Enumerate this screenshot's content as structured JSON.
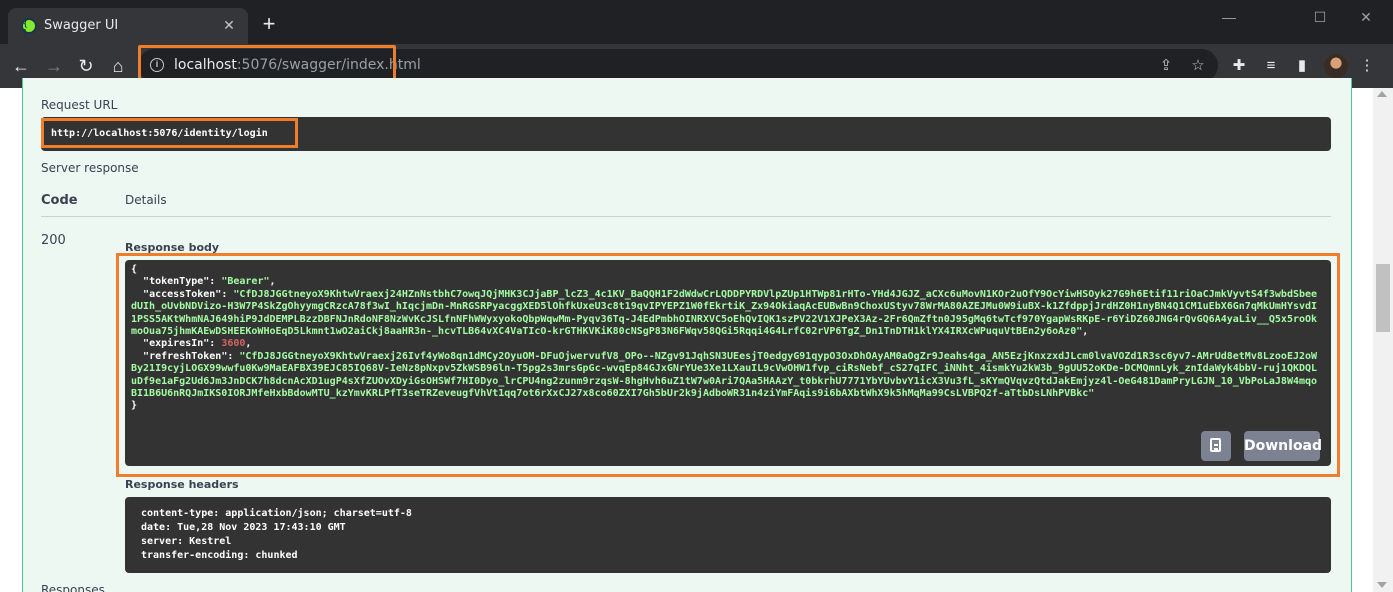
{
  "browser": {
    "tab_title": "Swagger UI",
    "url_host": "localhost",
    "url_rest": ":5076/swagger/index.html"
  },
  "request_url": {
    "label": "Request URL",
    "value": "http://localhost:5076/identity/login"
  },
  "server_response": {
    "label": "Server response",
    "code_header": "Code",
    "details_header": "Details",
    "code": "200",
    "body_label": "Response body",
    "body": {
      "open": "{",
      "token_type_key": "  \"tokenType\": ",
      "token_type_value": "\"Bearer\"",
      "access_token_key": "  \"accessToken\": ",
      "access_token_value": "\"CfDJ8JGGtneyoX9KhtwVraexj24HZnNstbhC7owqJQjMHK3CJjaBP_lcZ3_4c1KV_BaQQH1F2dWdwCrLQDDPYRDVlpZUp1HTWp81rHTo-YHd4JGJZ_aCXc6uMovN1KOr2uOfY9OcYiwHSOyk27G9h6Etif11riOaCJmkVyvtS4f3wbdSbeedUIh_oUvbNDVizo-H3W7P4SkZgOhyymgCRzcA78f3wI_hIqcjmDn-MnRGSRPyacggXED5lOhfkUxeU3c8t19qvIPYEPZ1W0fEkrtiK_Zx94OkiaqAcEUBwBn9ChoxUStyv78WrMA80AZEJMu0W9iuBX-k1ZfdppjJrdHZ0H1nyBN4Q1CM1uEbX6Gn7qMkUmHYsvdI1PSS5AKtWhmNAJ649hiP9JdDEMPLBzzDBFNJnRdoNF8NzWvKcJSLfnNFhWWyxyokoQbpWqwMm-Pyqv36Tq-J4EdPmbhOINRXVC5oEhQvIQK1szPV22V1XJPeX3Az-2Fr6QmZftn0J95gMq6twTcf970YgapWsRKpE-r6YiDZ60JNG4rQvGQ6A4yaLiv__Q5x5roOkmoOua75jhmKAEwDSHEEKoWHoEqD5Lkmnt1wO2aiCkj8aaHR3n-_hcvTLB64vXC4VaTIcO-krGTHKVKiK80cNSgP83N6FWqv58QGi5Rqqi4G4LrfC02rVP6TgZ_Dn1TnDTH1klYX4IRXcWPuquVtBEn2y6oAz0\"",
      "expires_in_key": "  \"expiresIn\": ",
      "expires_in_value": "3600",
      "refresh_token_key": "  \"refreshToken\": ",
      "refresh_token_value": "\"CfDJ8JGGtneyoX9KhtwVraexj26Ivf4yWo8qn1dMCy2OyuOM-DFuOjwervufV8_OPo--NZgv91JqhSN3UEesjT0edgyG91qypO3OxDhOAyAM0aOgZr9Jeahs4ga_AN5EzjKnxzxdJLcm0lvaVOZd1R3sc6yv7-AMrUd8etMv8LzooEJ2oWBy21I9cyjLOGX99wwfu0Kw9MaEAFBX39EJC85IQ68V-IeNz8pNxpv5ZkWSB96ln-T5pg2s3mrsGpGc-wvqEp84GJxGNrYUe3Xe1LXauIL9cVwOHW1fvp_ciRsNebf_cS27qIFC_iNNht_4ismkYu2kW3b_9gUU52oKDe-DCMQmnLyk_znIdaWyk4bbV-ruj1QKDQLuDf9e1aFg2Ud6Jm3JnDCK7h8dcnAcXD1ugP4sXfZUOvXDyiGsOHSWf7HI0Dyo_lrCPU4ng2zunm9rzqsW-8hgHvh6uZ1tW7w0Ari7QAa5HAAzY_t0bkrhU7771YbYUvbvY1icX3Vu3fL_sKYmQVqvzQtdJakEmjyz4l-OeG481DamPryLGJN_10_VbPoLaJ8W4mqoBI1B6U6nRQJmIKS0IORJMfeHxbBdowMTU_kzYmvKRLPfT3seTRZeveugfVhVt1qq7ot6rXxCJ27x8co60ZXI7Gh5bUr2k9jAdboWR31n4ziYmFAqis9i6bAXbtWhX9k5hMqMa99CsLVBPQ2f-aTtbDsLNhPVBkc\"",
      "close": "}"
    },
    "download_label": "Download",
    "headers_label": "Response headers",
    "headers": "content-type: application/json; charset=utf-8\ndate: Tue,28 Nov 2023 17:43:10 GMT\nserver: Kestrel\ntransfer-encoding: chunked"
  },
  "responses_label": "Responses"
}
